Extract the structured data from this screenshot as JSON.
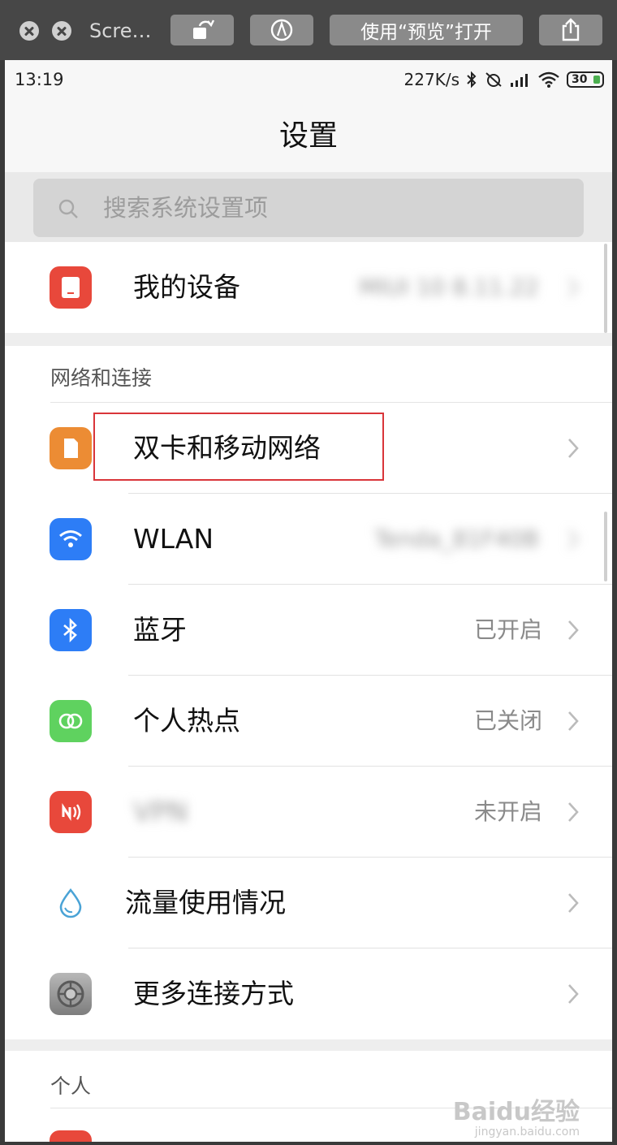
{
  "window": {
    "title": "Scre…",
    "open_with_label": "使用“预览”打开"
  },
  "statusbar": {
    "time": "13:19",
    "network_speed": "227K/s",
    "battery_level": "30"
  },
  "header": {
    "title": "设置"
  },
  "search": {
    "placeholder": "搜索系统设置项"
  },
  "top_item": {
    "label": "我的设备",
    "value": "MIUI 10 8.11.22",
    "icon": "device-icon",
    "icon_color": "#e8483b"
  },
  "sections": [
    {
      "header": "网络和连接",
      "items": [
        {
          "label": "双卡和移动网络",
          "value": "",
          "icon": "sim-card-icon",
          "icon_color": "#ec8c34"
        },
        {
          "label": "WLAN",
          "value": "Tenda_81F40B",
          "icon": "wifi-icon",
          "icon_color": "#2d7df6"
        },
        {
          "label": "蓝牙",
          "value": "已开启",
          "icon": "bluetooth-icon",
          "icon_color": "#2d7df6"
        },
        {
          "label": "个人热点",
          "value": "已关闭",
          "icon": "hotspot-icon",
          "icon_color": "#5fd25f"
        },
        {
          "label": "VPN",
          "value": "未开启",
          "icon": "vpn-icon",
          "icon_color": "#e8483b"
        },
        {
          "label": "流量使用情况",
          "value": "",
          "icon": "data-usage-icon",
          "icon_color": "#4aa3d6"
        },
        {
          "label": "更多连接方式",
          "value": "",
          "icon": "gear-icon",
          "icon_color": "#8e8e8e"
        }
      ]
    },
    {
      "header": "个人"
    }
  ],
  "watermark": {
    "brand": "Baidu经验",
    "url": "jingyan.baidu.com"
  }
}
